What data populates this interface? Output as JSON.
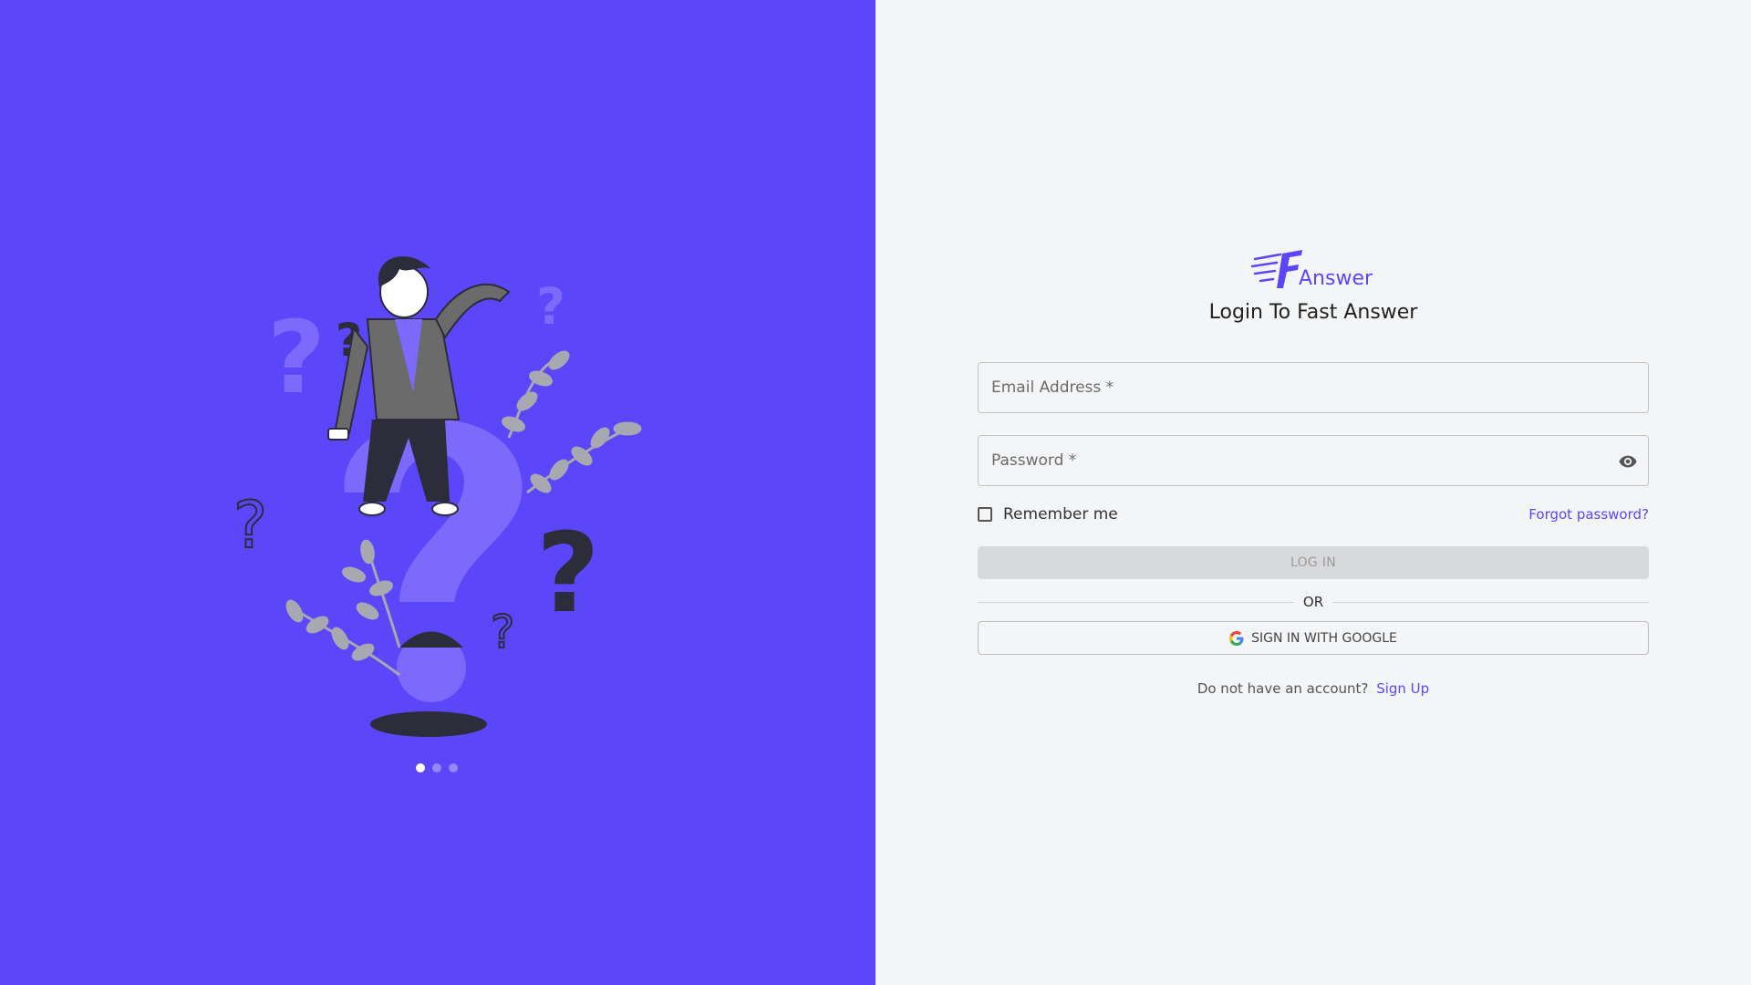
{
  "brand": {
    "logo_text": "Answer",
    "accent": "#5c46fa",
    "panel_bg": "#5c46fa"
  },
  "login": {
    "title": "Login To Fast Answer",
    "email_placeholder": "Email Address *",
    "password_placeholder": "Password *",
    "remember_label": "Remember me",
    "forgot_label": "Forgot password?",
    "login_label": "LOG IN",
    "or_label": "OR",
    "google_label": "SIGN IN WITH GOOGLE",
    "signup_prompt": "Do not have an account?",
    "signup_link": "Sign Up"
  },
  "carousel": {
    "active_index": 0,
    "count": 3
  },
  "icons": [
    "fast-answer-logo-icon",
    "visibility-eye-icon",
    "google-icon",
    "checkbox-icon"
  ]
}
